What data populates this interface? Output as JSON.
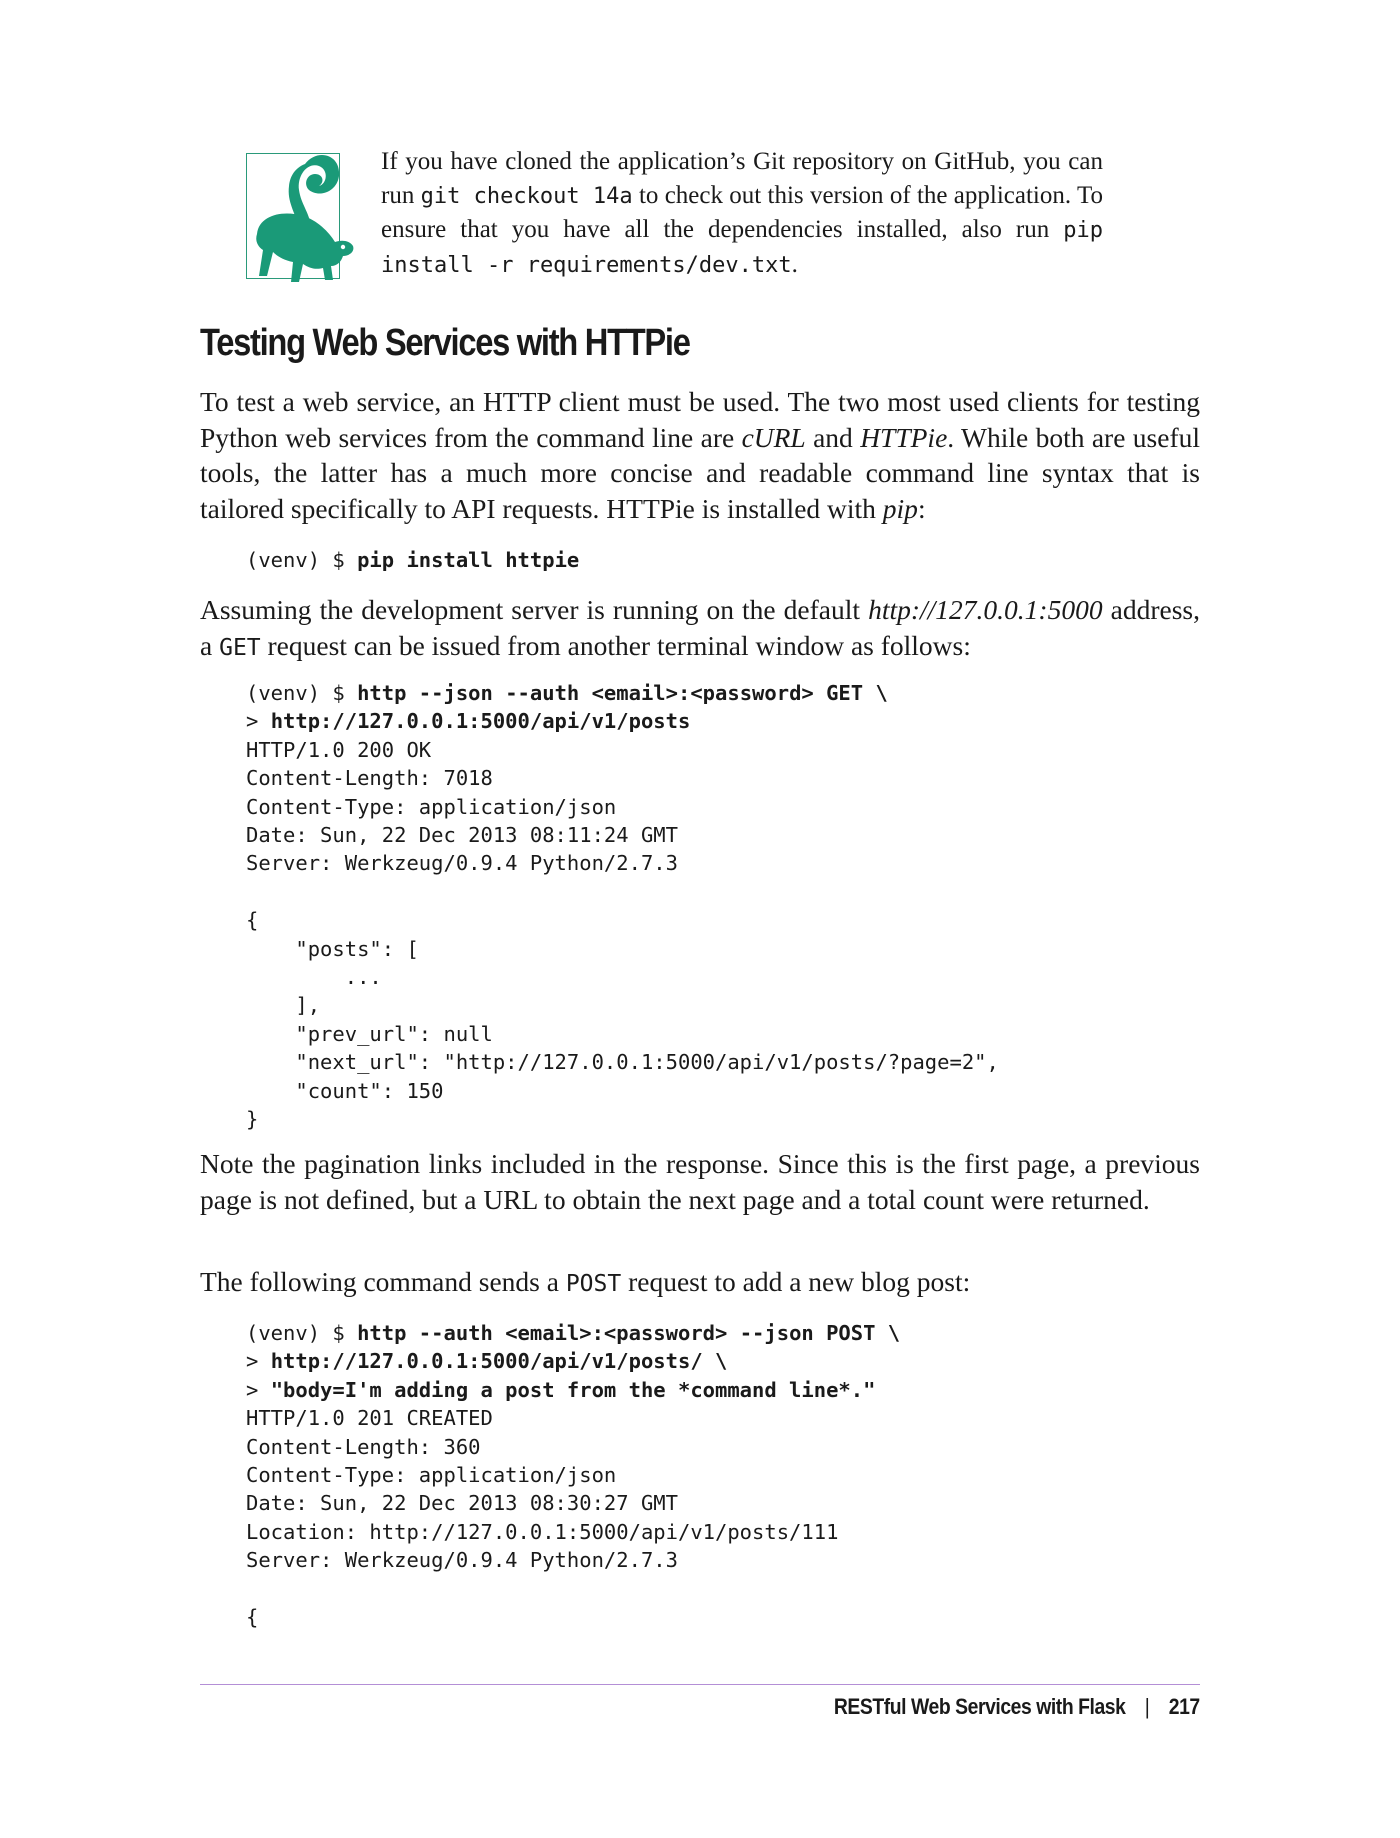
{
  "tip": {
    "icon": "lemur-icon",
    "line1": "If you have cloned the application’s Git repository on GitHub, you can run ",
    "code1": "git checkout 14a",
    "line2": " to check out this version of the application. To ensure that you have all the dependencies installed, also run ",
    "code2": "pip install -r requirements/dev.txt",
    "line3": "."
  },
  "section": {
    "title": "Testing Web Services with HTTPie"
  },
  "para1": {
    "a": "To test a web service, an HTTP client must be used. The two most used clients for testing Python web services from the command line are ",
    "curl": "cURL",
    "b": " and ",
    "httpie": "HTTPie",
    "c": ". While both are useful tools, the latter has a much more concise and readable command line syntax that is tailored specifically to API requests. HTTPie is installed with ",
    "pip": "pip",
    "d": ":"
  },
  "code1": {
    "prompt": "(venv) $ ",
    "command": "pip install httpie"
  },
  "para2": {
    "a": "Assuming the development server is running on the default ",
    "url": "http://127.0.0.1:5000",
    "b": " address, a ",
    "get": "GET",
    "c": " request can be issued from another terminal window as follows:"
  },
  "code2": {
    "prompt": "(venv) $ ",
    "cmd1": "http --json --auth <email>:<password> GET \\",
    "cont": "> ",
    "cmd2": "http://127.0.0.1:5000/api/v1/posts",
    "output": "HTTP/1.0 200 OK\nContent-Length: 7018\nContent-Type: application/json\nDate: Sun, 22 Dec 2013 08:11:24 GMT\nServer: Werkzeug/0.9.4 Python/2.7.3\n\n{\n    \"posts\": [\n        ...\n    ],\n    \"prev_url\": null\n    \"next_url\": \"http://127.0.0.1:5000/api/v1/posts/?page=2\",\n    \"count\": 150\n}"
  },
  "para3": {
    "text": "Note the pagination links included in the response. Since this is the first page, a previous page is not defined, but a URL to obtain the next page and a total count were returned."
  },
  "para4": {
    "a": "The following command sends a ",
    "post": "POST",
    "b": " request to add a new blog post:"
  },
  "code3": {
    "prompt": "(venv) $ ",
    "cmd1": "http --auth <email>:<password> --json POST \\",
    "cont1": "> ",
    "cmd2": "http://127.0.0.1:5000/api/v1/posts/ \\",
    "cont2": "> ",
    "cmd3": "\"body=I'm adding a post from the *command line*.\"",
    "output": "HTTP/1.0 201 CREATED\nContent-Length: 360\nContent-Type: application/json\nDate: Sun, 22 Dec 2013 08:30:27 GMT\nLocation: http://127.0.0.1:5000/api/v1/posts/111\nServer: Werkzeug/0.9.4 Python/2.7.3\n\n{"
  },
  "footer": {
    "chapter": "RESTful Web Services with Flask",
    "separator": "|",
    "page_number": "217"
  },
  "colors": {
    "tip_icon": "#1a9a78",
    "footer_rule": "#b48fd6"
  }
}
